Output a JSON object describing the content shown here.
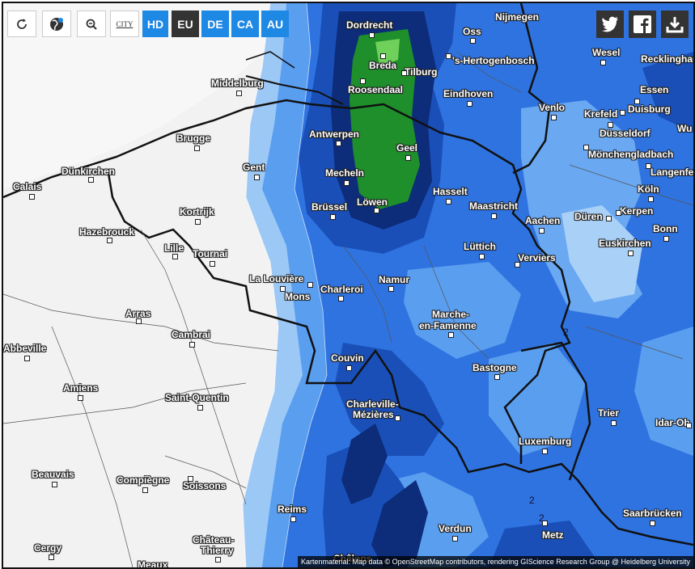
{
  "toolbar": {
    "refresh_icon": "refresh-icon",
    "globe_icon": "globe-icon",
    "zoom_out_icon": "zoom-out-icon",
    "city_label": "CITY",
    "hd_label": "HD",
    "eu_label": "EU",
    "de_label": "DE",
    "ca_label": "CA",
    "au_label": "AU"
  },
  "social": {
    "twitter_icon": "twitter-icon",
    "facebook_icon": "facebook-icon",
    "download_icon": "download-icon"
  },
  "map": {
    "contour_labels": [
      "2",
      "2",
      "2"
    ],
    "attribution": "Kartenmaterial: Map data © OpenStreetMap contributors, rendering GIScience Research Group @ Heidelberg University",
    "colors": {
      "land": "#f2f2f2",
      "light_blue": "#9cc8f5",
      "mid_blue": "#5a9ef0",
      "blue": "#2f73e0",
      "deep_blue": "#1a4fb8",
      "navy": "#0d2d7a",
      "green": "#1e8f2a",
      "light_green": "#6fd05a"
    }
  },
  "cities": {
    "dordrecht": "Dordrecht",
    "nijmegen": "Nijmegen",
    "oss": "Oss",
    "breda": "Breda",
    "tilburg": "Tilburg",
    "hertogenbosch": "'s-Hertogenbosch",
    "wesel": "Wesel",
    "recklinghausen": "Recklinghau",
    "middelburg": "Middelburg",
    "roosendaal": "Roosendaal",
    "eindhoven": "Eindhoven",
    "essen": "Essen",
    "venlo": "Venlo",
    "krefeld": "Krefeld",
    "duisburg": "Duisburg",
    "antwerpen": "Antwerpen",
    "brugge": "Brugge",
    "dusseldorf": "Düsseldorf",
    "wuppertal": "Wu",
    "geel": "Geel",
    "monchengladbach": "Mönchengladbach",
    "gent": "Gent",
    "mechelen": "Mecheln",
    "langenfeld": "Langenfe",
    "dunkirchen": "Dünkirchen",
    "calais": "Calais",
    "hasselt": "Hasselt",
    "koln": "Köln",
    "brussel": "Brüssel",
    "lowen": "Löwen",
    "maastricht": "Maastricht",
    "kerpen": "Kerpen",
    "kortrijk": "Kortrijk",
    "duren": "Düren",
    "aachen": "Aachen",
    "hazebrouck": "Hazebrouck",
    "bonn": "Bonn",
    "lille": "Lille",
    "tournai": "Tournai",
    "luttich": "Lüttich",
    "euskirchen": "Euskirchen",
    "verviers": "Verviers",
    "la_louviere": "La Louvière",
    "namur": "Namur",
    "charleroi": "Charleroi",
    "mons": "Mons",
    "arras": "Arras",
    "marche": "Marche-",
    "marche2": "en-Famenne",
    "cambrai": "Cambrai",
    "abbeville": "Abbeville",
    "couvin": "Couvin",
    "bastogne": "Bastogne",
    "amiens": "Amiens",
    "saint_quentin": "Saint-Quentin",
    "charleville": "Charleville-",
    "charleville2": "Mézières",
    "trier": "Trier",
    "idar": "Idar-Ob",
    "luxemburg": "Luxemburg",
    "beauvais": "Beauvais",
    "compiegne": "Compiègne",
    "soissons": "Soissons",
    "reims": "Reims",
    "saarbrucken": "Saarbrücken",
    "verdun": "Verdun",
    "metz": "Metz",
    "cergy": "Cergy",
    "chateau": "Château-",
    "chateau2": "Thierry",
    "chalons": "Châlons",
    "meaux": "Meaux"
  }
}
